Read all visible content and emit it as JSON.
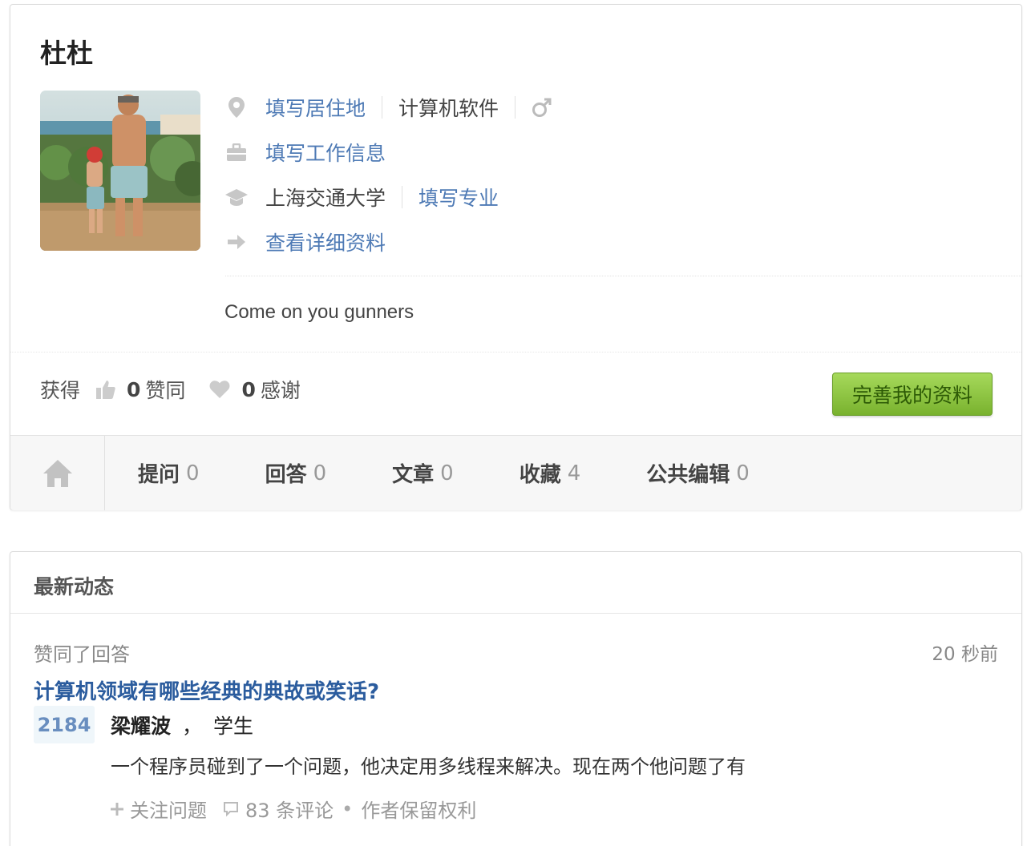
{
  "profile": {
    "name": "杜杜",
    "location_link": "填写居住地",
    "industry": "计算机软件",
    "work_link": "填写工作信息",
    "school": "上海交通大学",
    "major_link": "填写专业",
    "details_link": "查看详细资料",
    "bio": "Come on you gunners"
  },
  "stats": {
    "prefix": "获得",
    "agree_count": "0",
    "agree_label": "赞同",
    "thanks_count": "0",
    "thanks_label": "感谢"
  },
  "complete_button": "完善我的资料",
  "tabs": [
    {
      "label": "提问",
      "count": "0"
    },
    {
      "label": "回答",
      "count": "0"
    },
    {
      "label": "文章",
      "count": "0"
    },
    {
      "label": "收藏",
      "count": "4"
    },
    {
      "label": "公共编辑",
      "count": "0"
    }
  ],
  "feed": {
    "title": "最新动态",
    "item": {
      "action": "赞同了回答",
      "time": "20 秒前",
      "question": "计算机领域有哪些经典的典故或笑话?",
      "votes": "2184",
      "author_name": "梁耀波",
      "author_sep": "，",
      "author_title": "学生",
      "snippet": "一个程序员碰到了一个问题，他决定用多线程来解决。现在两个他问题了有",
      "follow": "关注问题",
      "comments": "83 条评论",
      "rights": "作者保留权利"
    }
  },
  "colors": {
    "link": "#4e7ab5",
    "question": "#2b5c9e",
    "button_green": "#8cc63f"
  }
}
